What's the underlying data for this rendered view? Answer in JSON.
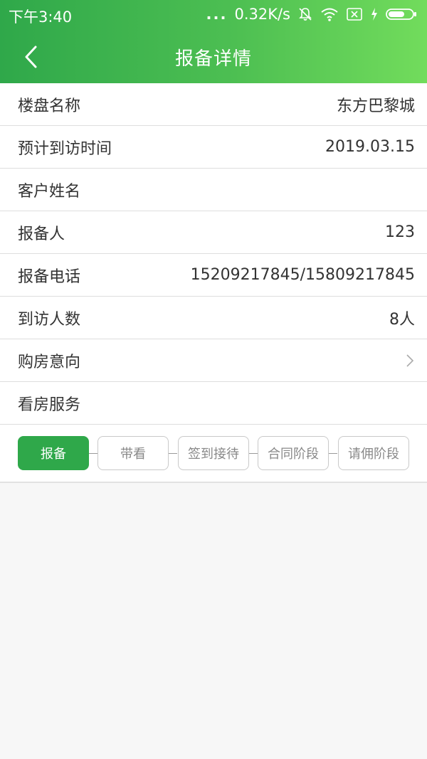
{
  "status": {
    "time": "下午3:40",
    "dots": "...",
    "speed": "0.32K/s",
    "icons": [
      "bell-muted-icon",
      "wifi-icon",
      "sim-icon",
      "charging-icon",
      "battery-icon"
    ]
  },
  "nav": {
    "title": "报备详情",
    "back_icon": "chevron-left-icon"
  },
  "rows": [
    {
      "label": "楼盘名称",
      "value": "东方巴黎城"
    },
    {
      "label": "预计到访时间",
      "value": "2019.03.15"
    },
    {
      "label": "客户姓名",
      "value": ""
    },
    {
      "label": "报备人",
      "value": "123"
    },
    {
      "label": "报备电话",
      "value": "15209217845/15809217845"
    },
    {
      "label": "到访人数",
      "value": "8人"
    },
    {
      "label": "购房意向",
      "value": "",
      "chevron": "chevron-right-icon"
    },
    {
      "label": "看房服务",
      "value": ""
    }
  ],
  "steps": [
    {
      "label": "报备",
      "active": true
    },
    {
      "label": "带看",
      "active": false
    },
    {
      "label": "签到接待",
      "active": false
    },
    {
      "label": "合同阶段",
      "active": false
    },
    {
      "label": "请佣阶段",
      "active": false
    }
  ],
  "colors": {
    "primary": "#2fa84a",
    "gradient_end": "#72dc5c"
  }
}
